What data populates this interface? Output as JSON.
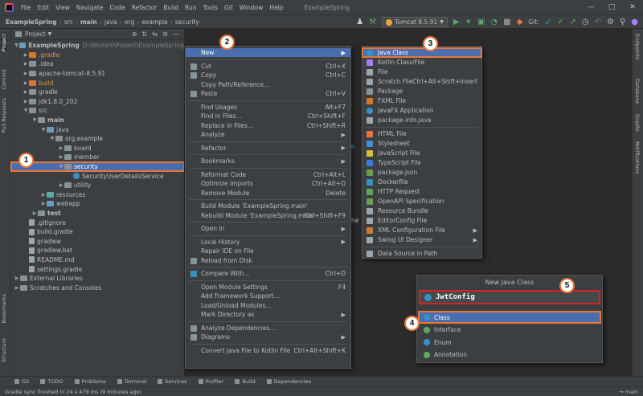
{
  "menubar": {
    "items": [
      "File",
      "Edit",
      "View",
      "Navigate",
      "Code",
      "Refactor",
      "Build",
      "Run",
      "Tools",
      "Git",
      "Window",
      "Help"
    ],
    "app_title": "ExampleSpring"
  },
  "navbar": {
    "crumbs": [
      "ExampleSpring",
      "src",
      "main",
      "java",
      "org",
      "example",
      "security"
    ],
    "run_config": "Tomcat 8.5.91",
    "git_label": "Git:"
  },
  "left_strip": {
    "project": "Project",
    "commit": "Commit",
    "pull_requests": "Pull Requests",
    "bookmarks": "Bookmarks",
    "structure": "Structure"
  },
  "right_strip": {
    "endpoints": "Endpoints",
    "database": "Database",
    "gradle": "Gradle",
    "notifications": "Notifications"
  },
  "project_panel": {
    "title": "Project",
    "tree": [
      {
        "label": "ExampleSpring",
        "extra": "D:\\Wintelli\\Project\\ExampleSpring",
        "indent": 0,
        "arrow": "down",
        "icon": "folder-blue",
        "bold": true
      },
      {
        "label": ".gradle",
        "indent": 1,
        "arrow": "right",
        "icon": "folder-orange",
        "orange": true
      },
      {
        "label": ".idea",
        "indent": 1,
        "arrow": "right",
        "icon": "folder-gray"
      },
      {
        "label": "apache-tomcat-8.5.91",
        "indent": 1,
        "arrow": "right",
        "icon": "folder-gray"
      },
      {
        "label": "build",
        "indent": 1,
        "arrow": "right",
        "icon": "folder-orange",
        "orange": true
      },
      {
        "label": "gradle",
        "indent": 1,
        "arrow": "right",
        "icon": "folder-gray"
      },
      {
        "label": "jdk1.8.0_202",
        "indent": 1,
        "arrow": "right",
        "icon": "folder-gray"
      },
      {
        "label": "src",
        "indent": 1,
        "arrow": "down",
        "icon": "folder-gray"
      },
      {
        "label": "main",
        "indent": 2,
        "arrow": "down",
        "icon": "folder-gray",
        "bold": true
      },
      {
        "label": "java",
        "indent": 3,
        "arrow": "down",
        "icon": "folder-blue"
      },
      {
        "label": "org.example",
        "indent": 4,
        "arrow": "down",
        "icon": "folder-pkg"
      },
      {
        "label": "board",
        "indent": 5,
        "arrow": "right",
        "icon": "folder-pkg"
      },
      {
        "label": "member",
        "indent": 5,
        "arrow": "right",
        "icon": "folder-pkg"
      },
      {
        "label": "security",
        "indent": 5,
        "arrow": "down",
        "icon": "folder-pkg",
        "selected": true
      },
      {
        "label": "SecurityUserDetailsService",
        "indent": 6,
        "arrow": "",
        "icon": "class"
      },
      {
        "label": "utility",
        "indent": 5,
        "arrow": "right",
        "icon": "folder-pkg"
      },
      {
        "label": "resources",
        "indent": 3,
        "arrow": "right",
        "icon": "folder-teal"
      },
      {
        "label": "webapp",
        "indent": 3,
        "arrow": "right",
        "icon": "folder-blue"
      },
      {
        "label": "test",
        "indent": 2,
        "arrow": "right",
        "icon": "folder-gray",
        "bold": true
      },
      {
        "label": ".gitignore",
        "indent": 1,
        "arrow": "",
        "icon": "file"
      },
      {
        "label": "build.gradle",
        "indent": 1,
        "arrow": "",
        "icon": "file"
      },
      {
        "label": "gradlew",
        "indent": 1,
        "arrow": "",
        "icon": "file"
      },
      {
        "label": "gradlew.bat",
        "indent": 1,
        "arrow": "",
        "icon": "file"
      },
      {
        "label": "README.md",
        "indent": 1,
        "arrow": "",
        "icon": "file"
      },
      {
        "label": "settings.gradle",
        "indent": 1,
        "arrow": "",
        "icon": "file"
      },
      {
        "label": "External Libraries",
        "indent": 0,
        "arrow": "right",
        "icon": "folder-gray"
      },
      {
        "label": "Scratches and Consoles",
        "indent": 0,
        "arrow": "right",
        "icon": "folder-gray"
      }
    ]
  },
  "context_menu": {
    "items": [
      {
        "label": "New",
        "shortcut": "",
        "submenu": true,
        "highlight": true
      },
      {
        "sep": true
      },
      {
        "label": "Cut",
        "shortcut": "Ctrl+X"
      },
      {
        "label": "Copy",
        "shortcut": "Ctrl+C"
      },
      {
        "label": "Copy Path/Reference...",
        "shortcut": ""
      },
      {
        "label": "Paste",
        "shortcut": "Ctrl+V"
      },
      {
        "sep": true
      },
      {
        "label": "Find Usages",
        "shortcut": "Alt+F7"
      },
      {
        "label": "Find in Files...",
        "shortcut": "Ctrl+Shift+F"
      },
      {
        "label": "Replace in Files...",
        "shortcut": "Ctrl+Shift+R"
      },
      {
        "label": "Analyze",
        "shortcut": "",
        "submenu": true
      },
      {
        "sep": true
      },
      {
        "label": "Refactor",
        "shortcut": "",
        "submenu": true
      },
      {
        "sep": true
      },
      {
        "label": "Bookmarks",
        "shortcut": "",
        "submenu": true
      },
      {
        "sep": true
      },
      {
        "label": "Reformat Code",
        "shortcut": "Ctrl+Alt+L"
      },
      {
        "label": "Optimize Imports",
        "shortcut": "Ctrl+Alt+O"
      },
      {
        "label": "Remove Module",
        "shortcut": "Delete"
      },
      {
        "sep": true
      },
      {
        "label": "Build Module 'ExampleSpring.main'",
        "shortcut": ""
      },
      {
        "label": "Rebuild Module 'ExampleSpring.main'",
        "shortcut": "Ctrl+Shift+F9"
      },
      {
        "sep": true
      },
      {
        "label": "Open In",
        "shortcut": "",
        "submenu": true
      },
      {
        "sep": true
      },
      {
        "label": "Local History",
        "shortcut": "",
        "submenu": true
      },
      {
        "label": "Repair IDE on File",
        "shortcut": ""
      },
      {
        "label": "Reload from Disk",
        "shortcut": ""
      },
      {
        "sep": true
      },
      {
        "label": "Compare With...",
        "shortcut": "Ctrl+D"
      },
      {
        "sep": true
      },
      {
        "label": "Open Module Settings",
        "shortcut": "F4"
      },
      {
        "label": "Add Framework Support...",
        "shortcut": ""
      },
      {
        "label": "Load/Unload Modules...",
        "shortcut": ""
      },
      {
        "label": "Mark Directory as",
        "shortcut": "",
        "submenu": true
      },
      {
        "sep": true
      },
      {
        "label": "Analyze Dependencies...",
        "shortcut": ""
      },
      {
        "label": "Diagrams",
        "shortcut": "",
        "submenu": true
      },
      {
        "sep": true
      },
      {
        "label": "Convert Java File to Kotlin File",
        "shortcut": "Ctrl+Alt+Shift+K"
      }
    ]
  },
  "new_submenu": {
    "items": [
      {
        "label": "Java Class",
        "color": "#3592c4",
        "highlight": true
      },
      {
        "label": "Kotlin Class/File",
        "color": "#a97bff"
      },
      {
        "label": "File",
        "color": "#9aa7b0"
      },
      {
        "label": "Scratch File",
        "shortcut": "Ctrl+Alt+Shift+Insert",
        "color": "#9aa7b0"
      },
      {
        "label": "Package",
        "color": "#87939a"
      },
      {
        "label": "FXML File",
        "color": "#d07b2b"
      },
      {
        "label": "JavaFX Application",
        "color": "#3592c4"
      },
      {
        "label": "package-info.java",
        "color": "#9aa7b0"
      },
      {
        "sep": true
      },
      {
        "label": "HTML File",
        "color": "#e8763a"
      },
      {
        "label": "Stylesheet",
        "color": "#3d8fd1"
      },
      {
        "label": "JavaScript File",
        "color": "#d6bf3f"
      },
      {
        "label": "TypeScript File",
        "color": "#3a7bd5"
      },
      {
        "label": "package.json",
        "color": "#6a9f4b"
      },
      {
        "label": "Dockerfile",
        "color": "#3592c4"
      },
      {
        "label": "HTTP Request",
        "color": "#5ca55c"
      },
      {
        "label": "OpenAPI Specification",
        "color": "#6a9f4b"
      },
      {
        "label": "Resource Bundle",
        "color": "#9aa7b0"
      },
      {
        "label": "EditorConfig File",
        "color": "#9aa7b0"
      },
      {
        "label": "XML Configuration File",
        "color": "#d07b2b",
        "submenu": true
      },
      {
        "label": "Swing UI Designer",
        "color": "#9aa7b0",
        "submenu": true
      },
      {
        "sep": true
      },
      {
        "label": "Data Source in Path",
        "color": "#9aa7b0"
      }
    ]
  },
  "dialog": {
    "title": "New Java Class",
    "input_value": "JwtConfig",
    "options": [
      {
        "label": "Class",
        "color": "#3592c4",
        "highlight": true
      },
      {
        "label": "Interface",
        "color": "#5fa85f"
      },
      {
        "label": "Enum",
        "color": "#3592c4"
      },
      {
        "label": "Annotation",
        "color": "#5fa85f"
      }
    ]
  },
  "badges": [
    "1",
    "2",
    "3",
    "4",
    "5"
  ],
  "editor_fragments": [
    "ole",
    "he"
  ],
  "bottom_tools": [
    "Git",
    "TODO",
    "Problems",
    "Terminal",
    "Services",
    "Profiler",
    "Build",
    "Dependencies"
  ],
  "status": {
    "message": "Gradle sync finished in 24 s 479 ms (9 minutes ago)",
    "branch": "main"
  },
  "colors": {
    "selection": "#4b6eaf",
    "annotation_orange": "#e8763a",
    "annotation_red": "#d62222"
  }
}
